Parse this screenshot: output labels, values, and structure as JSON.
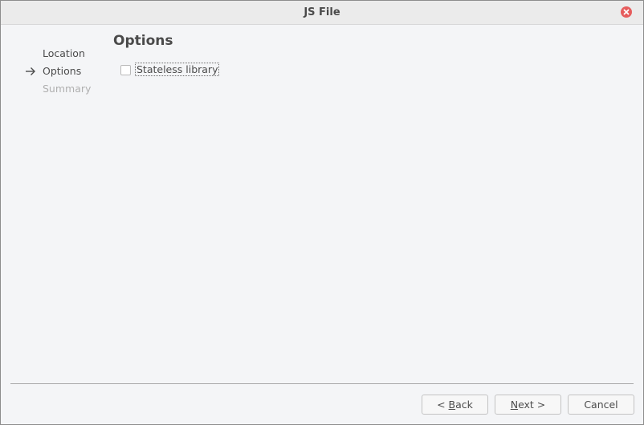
{
  "window": {
    "title": "JS File"
  },
  "steps": [
    {
      "label": "Location",
      "state": "done"
    },
    {
      "label": "Options",
      "state": "current"
    },
    {
      "label": "Summary",
      "state": "future"
    }
  ],
  "page": {
    "title": "Options",
    "options": [
      {
        "label": "Stateless library",
        "checked": false
      }
    ]
  },
  "buttons": {
    "back": {
      "prefix": "< ",
      "mnemonic": "B",
      "rest": "ack"
    },
    "next": {
      "prefix": "",
      "mnemonic": "N",
      "rest": "ext >"
    },
    "cancel": {
      "label": "Cancel"
    }
  },
  "colors": {
    "close_button": "#e65d5d",
    "background": "#f4f5f7"
  }
}
